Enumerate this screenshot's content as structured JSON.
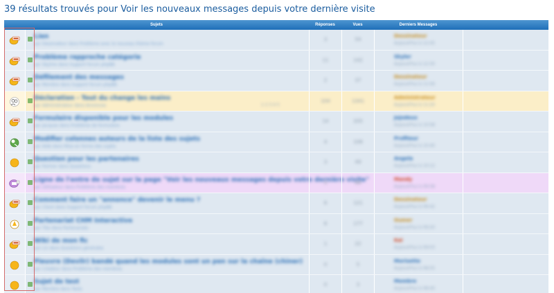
{
  "results_title": "39 résultats trouvés pour Voir les nouveaux messages depuis votre dernière visite",
  "columns": {
    "subjects": "Sujets",
    "replies": "Réponses",
    "views": "Vues",
    "last": "Derniers Messages"
  },
  "rows": [
    {
      "icon": "en-cours-icon",
      "style": "normal",
      "title": "Lien",
      "sub": "par Dessinateur dans Problème avec le nouveau thème forum",
      "replies": "3",
      "views": "54",
      "last_user": "Dessinateur",
      "last_user_color": "gold",
      "last_date": "Aujourd'hui à 12:45"
    },
    {
      "icon": "en-cours-icon",
      "style": "normal",
      "title": "Problème rapproche catégorie",
      "sub": "par Skyline dans Support forum phpBB",
      "replies": "11",
      "views": "142",
      "last_user": "Skyler",
      "last_user_color": "blue",
      "last_date": "Aujourd'hui à 12:30"
    },
    {
      "icon": "en-cours-icon",
      "style": "normal",
      "title": "Défilement des messages",
      "sub": "par Membre dans Support forum phpBB",
      "replies": "2",
      "views": "37",
      "last_user": "Dessinateur",
      "last_user_color": "gold",
      "last_date": "Aujourd'hui à 11:56"
    },
    {
      "icon": "users-icon",
      "style": "yellow",
      "title": "Déclaration - Tout du change les mains",
      "sub": "par Administrateur dans Annonces",
      "pages": "1  2  3  4  5",
      "replies": "104",
      "views": "1341",
      "last_user": "Administrateur",
      "last_user_color": "gold",
      "last_date": "Aujourd'hui à 11:20"
    },
    {
      "icon": "en-cours-icon",
      "style": "normal",
      "title": "Formulaire disponible pour les modules",
      "sub": "par Jacques dans Problème de formulaire",
      "replies": "14",
      "views": "205",
      "last_user": "Jojodeux",
      "last_user_color": "blue",
      "last_date": "Aujourd'hui à 10:58"
    },
    {
      "icon": "resolved-icon",
      "style": "normal",
      "title": "Modifier colonnes auteurs de la liste des sujets",
      "sub": "par Aide dans Mise en forme des sujets",
      "replies": "4",
      "views": "108",
      "last_user": "Profiteur",
      "last_user_color": "blue",
      "last_date": "Aujourd'hui à 10:40"
    },
    {
      "icon": "circle-icon",
      "style": "normal",
      "title": "Question pour les partenaires",
      "sub": "par Partner dans Questions",
      "replies": "3",
      "views": "49",
      "last_user": "Angela",
      "last_user_color": "blue",
      "last_date": "Aujourd'hui à 10:12"
    },
    {
      "icon": "locked-icon",
      "style": "purple",
      "title": "Ligne de l'entre de sujet sur la page \"Voir les nouveaux messages depuis votre dernière visite\"",
      "sub": "par Utilisateur dans Problème des membres",
      "replies": "5",
      "views": "86",
      "last_user": "Mandy",
      "last_user_color": "red",
      "last_date": "Aujourd'hui à 09:58"
    },
    {
      "icon": "en-cours-icon",
      "style": "normal",
      "title": "Comment faire un \"annonce\" devenir le menu ?",
      "sub": "par Client dans Support forum phpBB",
      "replies": "6",
      "views": "121",
      "last_user": "Dessinateur",
      "last_user_color": "gold",
      "last_date": "Aujourd'hui à 09:42"
    },
    {
      "icon": "warning-icon",
      "style": "normal",
      "title": "Partenariat CHM Interactive",
      "sub": "par Tiko dans Partenariats",
      "replies": "8",
      "views": "177",
      "last_user": "Oumer",
      "last_user_color": "gold",
      "last_date": "Aujourd'hui à 09:20"
    },
    {
      "icon": "en-cours-icon",
      "style": "normal",
      "title": "Wiki de mon fic",
      "sub": "par Lin dans Questions générales",
      "replies": "1",
      "views": "22",
      "last_user": "Kai",
      "last_user_color": "red",
      "last_date": "Aujourd'hui à 09:03"
    },
    {
      "icon": "circle-icon",
      "style": "normal",
      "title": "Pieuvre (Devilr) bandé quand les modules sont un pen sur la chaîne (chiner)",
      "sub": "par Créateur dans Problème des membres",
      "replies": "0",
      "views": "5",
      "last_user": "Morisette",
      "last_user_color": "blue",
      "last_date": "Aujourd'hui à 08:55"
    },
    {
      "icon": "circle-icon",
      "style": "normal",
      "title": "Sujet de test",
      "sub": "par Membre dans Tests",
      "replies": "0",
      "views": "3",
      "last_user": "Membre",
      "last_user_color": "blue",
      "last_date": "Aujourd'hui à 08:40"
    }
  ]
}
